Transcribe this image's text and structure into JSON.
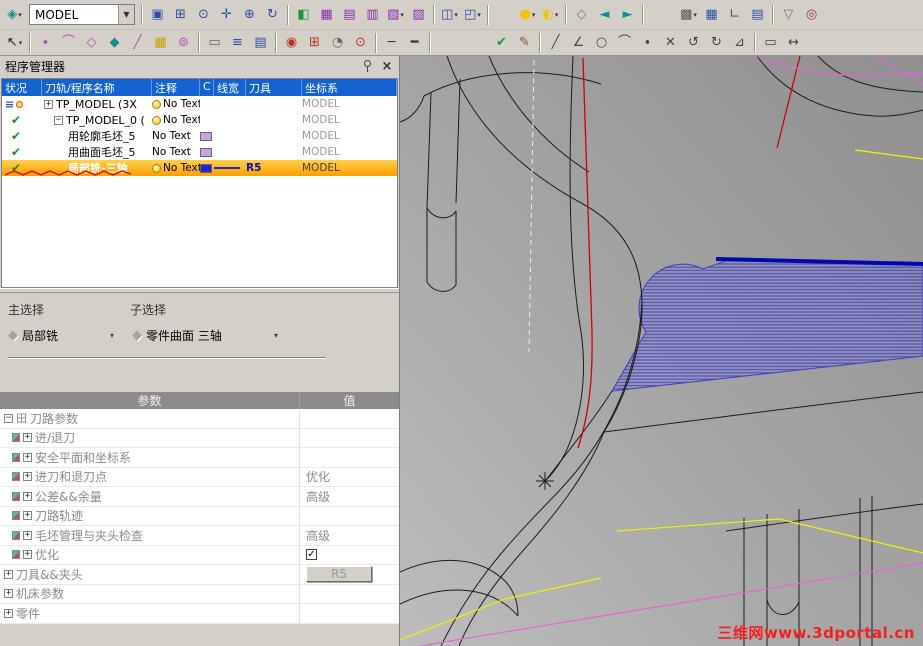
{
  "toolbar": {
    "model_combo": "MODEL",
    "row1_left": [
      {
        "name": "select-filter-button",
        "glyph": "◈",
        "color": "#0a8f8f",
        "dd": true
      }
    ],
    "row1": [
      {
        "sep": true
      },
      {
        "name": "zoom-window-button",
        "glyph": "▣",
        "color": "#2b50a8"
      },
      {
        "name": "zoom-scale-button",
        "glyph": "⊞",
        "color": "#2b50a8"
      },
      {
        "name": "zoom-button",
        "glyph": "⊙",
        "color": "#2b50a8"
      },
      {
        "name": "pan-button",
        "glyph": "✛",
        "color": "#2b50a8"
      },
      {
        "name": "fit-view-button",
        "glyph": "⊕",
        "color": "#2b50a8"
      },
      {
        "name": "redraw-button",
        "glyph": "↻",
        "color": "#2b50a8"
      },
      {
        "sep": true
      },
      {
        "name": "shaded-display-button",
        "glyph": "◧",
        "color": "#189a2e"
      },
      {
        "name": "wireframe-display-button",
        "glyph": "▦",
        "color": "#8a2bb0"
      },
      {
        "name": "hidden-line-button",
        "glyph": "▤",
        "color": "#8a2bb0"
      },
      {
        "name": "section-display-button",
        "glyph": "▥",
        "color": "#8a2bb0"
      },
      {
        "name": "display-options-button",
        "glyph": "▧",
        "color": "#8a2bb0",
        "dd": true
      },
      {
        "name": "render-mode-button",
        "glyph": "▨",
        "color": "#8a2bb0"
      },
      {
        "sep": true
      },
      {
        "name": "split-window-button",
        "glyph": "◫",
        "color": "#2b50a8",
        "dd": true
      },
      {
        "name": "named-views-button",
        "glyph": "◰",
        "color": "#2b50a8",
        "dd": true
      },
      {
        "sep": true
      },
      {
        "spacer": 24
      },
      {
        "name": "show-entities-button",
        "glyph": "●",
        "color": "#f2c400",
        "dd": true
      },
      {
        "name": "hide-entities-button",
        "glyph": "◐",
        "color": "#f2c400",
        "dd": true
      },
      {
        "sep": true
      },
      {
        "name": "diamond-marker-button",
        "glyph": "◇",
        "color": "#777777"
      },
      {
        "name": "previous-feature-button",
        "glyph": "◄",
        "color": "#0a8f8f"
      },
      {
        "name": "next-feature-button",
        "glyph": "►",
        "color": "#0a8f8f"
      },
      {
        "sep": true
      },
      {
        "spacer": 30
      },
      {
        "name": "pattern-display-button",
        "glyph": "▩",
        "color": "#555555",
        "dd": true
      },
      {
        "name": "grid-button",
        "glyph": "▦",
        "color": "#2b50a8"
      },
      {
        "name": "axes-button",
        "glyph": "∟",
        "color": "#555555"
      },
      {
        "name": "attribute-table-button",
        "glyph": "▤",
        "color": "#2b50a8"
      },
      {
        "sep": true
      },
      {
        "name": "filter-button",
        "glyph": "▽",
        "color": "#777777"
      },
      {
        "name": "target-button",
        "glyph": "◎",
        "color": "#b03030"
      }
    ],
    "row2": [
      {
        "name": "pick-arrow-button",
        "glyph": "↖",
        "color": "#222222",
        "dd": true
      },
      {
        "sep": true
      },
      {
        "name": "filter-points-button",
        "glyph": "∙",
        "color": "#b050b0"
      },
      {
        "name": "filter-curves-button",
        "glyph": "⌒",
        "color": "#b050b0"
      },
      {
        "name": "filter-surfaces-button",
        "glyph": "◇",
        "color": "#b050b0"
      },
      {
        "name": "filter-solids-button",
        "glyph": "◆",
        "color": "#0a8f8f"
      },
      {
        "name": "filter-edges-button",
        "glyph": "╱",
        "color": "#b050b0"
      },
      {
        "name": "filter-color-button",
        "glyph": "▦",
        "color": "#c8a000"
      },
      {
        "name": "snap-options-button",
        "glyph": "⊚",
        "color": "#b050b0"
      },
      {
        "sep": true
      },
      {
        "name": "keyboard-entry-button",
        "glyph": "▭",
        "color": "#666666"
      },
      {
        "name": "feature-list-button",
        "glyph": "≡",
        "color": "#2b50a8"
      },
      {
        "name": "document-list-button",
        "glyph": "▤",
        "color": "#2b50a8"
      },
      {
        "sep": true
      },
      {
        "name": "analyze-button",
        "glyph": "◉",
        "color": "#c03020"
      },
      {
        "name": "measure-button",
        "glyph": "⊞",
        "color": "#c03020"
      },
      {
        "name": "calculator-button",
        "glyph": "◔",
        "color": "#666666"
      },
      {
        "name": "preview-button",
        "glyph": "⊙",
        "color": "#c03020"
      },
      {
        "sep": true
      },
      {
        "name": "line-width-thin-button",
        "glyph": "─",
        "color": "#333333"
      },
      {
        "name": "line-width-thick-button",
        "glyph": "━",
        "color": "#333333"
      },
      {
        "sep": true
      },
      {
        "spacer": 56
      },
      {
        "name": "check-button",
        "glyph": "✔",
        "color": "#189a2e"
      },
      {
        "name": "sketch-button",
        "glyph": "✎",
        "color": "#8a5a20"
      },
      {
        "sep": true
      },
      {
        "name": "draw-line-button",
        "glyph": "╱",
        "color": "#444444"
      },
      {
        "name": "draw-polyline-button",
        "glyph": "∠",
        "color": "#444444"
      },
      {
        "name": "draw-circle-button",
        "glyph": "○",
        "color": "#444444"
      },
      {
        "name": "draw-arc-button",
        "glyph": "⌒",
        "color": "#444444"
      },
      {
        "name": "draw-point-button",
        "glyph": "∙",
        "color": "#444444"
      },
      {
        "name": "delete-button",
        "glyph": "✕",
        "color": "#444444"
      },
      {
        "name": "undo-button",
        "glyph": "↺",
        "color": "#444444"
      },
      {
        "name": "redo-button",
        "glyph": "↻",
        "color": "#444444"
      },
      {
        "name": "draw-tangent-button",
        "glyph": "⊿",
        "color": "#444444"
      },
      {
        "sep": true
      },
      {
        "name": "rectangle-button",
        "glyph": "▭",
        "color": "#444444"
      },
      {
        "name": "dimension-button",
        "glyph": "↔",
        "color": "#444444"
      }
    ]
  },
  "program_manager": {
    "title": "程序管理器",
    "columns": [
      "状况",
      "刀轨/程序名称",
      "注释",
      "C",
      "线宽",
      "刀具",
      "坐标系"
    ],
    "rows": [
      {
        "expand": "+",
        "name": "TP_MODEL (3X",
        "note": "No Text",
        "csys": "MODEL",
        "bulb": true,
        "level": 0
      },
      {
        "expand": "−",
        "name": "TP_MODEL_0 (",
        "note": "No Text",
        "csys": "MODEL",
        "bulb": true,
        "level": 1
      },
      {
        "name": "用轮廓毛坯_5",
        "note": "No Text",
        "csys": "MODEL",
        "swatch": "#c9a2ea",
        "level": 2
      },
      {
        "name": "用曲面毛坯_5",
        "note": "No Text",
        "csys": "MODEL",
        "swatch": "#c9a2ea",
        "level": 2
      },
      {
        "name": "局部铣-三轴",
        "note": "No Text",
        "csys": "MODEL",
        "swatch": "#2525cf",
        "line": "#2525cf",
        "tool": "R5",
        "bulb": true,
        "level": 2,
        "selected": true
      }
    ]
  },
  "selection": {
    "main_label": "主选择",
    "sub_label": "子选择",
    "main_value": "局部铣",
    "sub_value": "零件曲面 三轴"
  },
  "parameters": {
    "param_header": "参数",
    "value_header": "值",
    "rows": [
      {
        "label": "刀路参数",
        "value": "",
        "icon": "collapse"
      },
      {
        "label": "进/退刀",
        "value": "",
        "icon": "key"
      },
      {
        "label": "安全平面和坐标系",
        "value": "",
        "icon": "key"
      },
      {
        "label": "进刀和退刀点",
        "value": "优化",
        "icon": "key"
      },
      {
        "label": "公差&&余量",
        "value": "高级",
        "icon": "key"
      },
      {
        "label": "刀路轨迹",
        "value": "",
        "icon": "key"
      },
      {
        "label": "毛坯管理与夹头检查",
        "value": "高级",
        "icon": "key"
      },
      {
        "label": "优化",
        "value": "",
        "icon": "key",
        "checkbox": true
      },
      {
        "label": "刀具&&夹头",
        "value": "R5",
        "icon": "expand",
        "button": true
      },
      {
        "label": "机床参数",
        "value": "",
        "icon": "expand"
      },
      {
        "label": "零件",
        "value": "",
        "icon": "expand"
      }
    ]
  },
  "viewport": {
    "watermark": "三维网www.3dportal.cn"
  }
}
